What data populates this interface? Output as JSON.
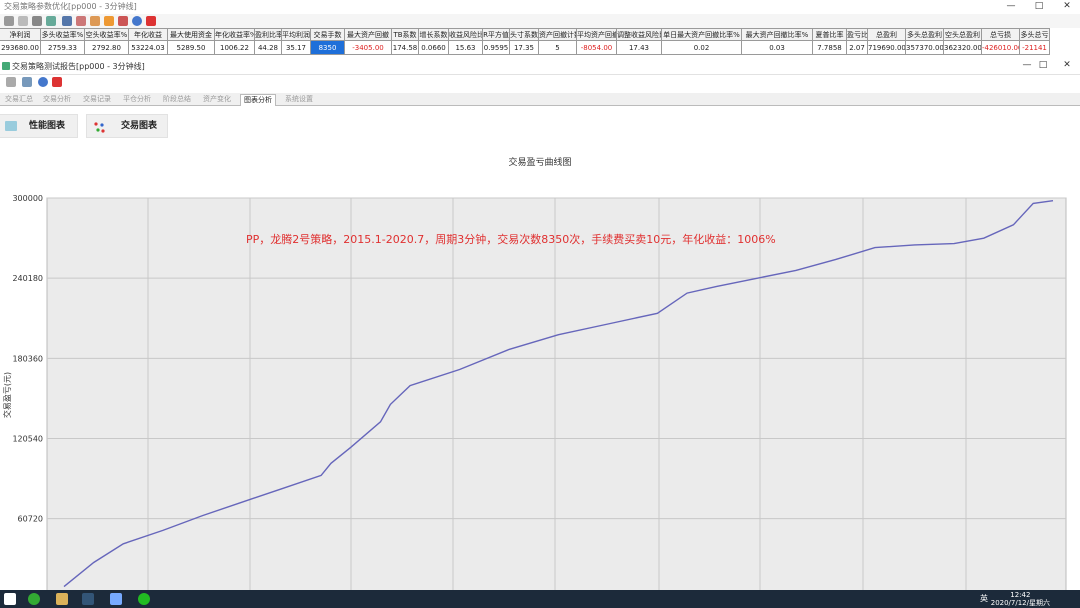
{
  "outer_window": {
    "title": "交易策略参数优化[pp000 - 3分钟线]",
    "controls": [
      "—",
      "□",
      "✕"
    ]
  },
  "stats": {
    "columns": [
      {
        "header": "净利润",
        "value": "293680.00"
      },
      {
        "header": "多头收益率%",
        "value": "2759.33"
      },
      {
        "header": "空头收益率%",
        "value": "2792.80"
      },
      {
        "header": "年化收益",
        "value": "53224.03"
      },
      {
        "header": "最大使用资金",
        "value": "5289.50"
      },
      {
        "header": "年化收益率%",
        "value": "1006.22"
      },
      {
        "header": "盈利比率",
        "value": "44.28"
      },
      {
        "header": "平均利润",
        "value": "35.17"
      },
      {
        "header": "交易手数",
        "value": "8350"
      },
      {
        "header": "最大资产回撤",
        "value": "-3405.00"
      },
      {
        "header": "TB系数",
        "value": "174.58"
      },
      {
        "header": "增长系数",
        "value": "0.0660"
      },
      {
        "header": "收益风险比",
        "value": "15.63"
      },
      {
        "header": "R平方值",
        "value": "0.9595"
      },
      {
        "header": "头寸系数",
        "value": "17.35"
      },
      {
        "header": "资产回撤计数",
        "value": "5"
      },
      {
        "header": "平均资产回撤",
        "value": "-8054.00"
      },
      {
        "header": "调整收益风险比",
        "value": "17.43"
      },
      {
        "header": "单日最大资产回撤比率%",
        "value": "0.02"
      },
      {
        "header": "最大资产回撤比率%",
        "value": "0.03"
      },
      {
        "header": "夏普比率",
        "value": "7.7858"
      },
      {
        "header": "盈亏比",
        "value": "2.07"
      },
      {
        "header": "总盈利",
        "value": "719690.00"
      },
      {
        "header": "多头总盈利",
        "value": "357370.00"
      },
      {
        "header": "空头总盈利",
        "value": "362320.00"
      },
      {
        "header": "总亏损",
        "value": "-426010.00"
      },
      {
        "header": "多头总亏",
        "value": "-21141"
      }
    ]
  },
  "inner_window": {
    "title": "交易策略测试报告[pp000 - 3分钟线]",
    "controls": [
      "—",
      "□",
      "✕"
    ]
  },
  "tabs": [
    "交易汇总",
    "交易分析",
    "交易记录",
    "平仓分析",
    "阶段总结",
    "资产变化",
    "图表分析",
    "系统设置"
  ],
  "active_tab": "图表分析",
  "subtabs": [
    "性能图表",
    "交易图表"
  ],
  "colors": {
    "line": "#6666bb",
    "annotation": "#e03030",
    "selected_cell": "#1e6fd9",
    "taskbar": "#1c2a3a"
  },
  "taskbar": {
    "time": "12:42",
    "date": "2020/7/12/星期六",
    "lang": "英"
  },
  "chart_data": {
    "type": "line",
    "title": "交易盈亏曲线图",
    "ylabel": "交易盈亏(元)",
    "yticks": [
      60720,
      120540,
      180360,
      240180,
      300000
    ],
    "ylim": [
      6000,
      300000
    ],
    "annotation": "PP，龙腾2号策略，2015.1-2020.7，周期3分钟，交易次数8350次，手续费买卖10元，年化收益：1006%",
    "grid": true,
    "series": [
      {
        "x": [
          0,
          0.03,
          0.06,
          0.1,
          0.14,
          0.18,
          0.22,
          0.26,
          0.27,
          0.29,
          0.32,
          0.33,
          0.35,
          0.4,
          0.45,
          0.5,
          0.55,
          0.6,
          0.63,
          0.66,
          0.7,
          0.74,
          0.78,
          0.82,
          0.86,
          0.9,
          0.93,
          0.96,
          0.98,
          1.0
        ],
        "y": [
          10000,
          28000,
          42000,
          52000,
          63000,
          73000,
          83000,
          93000,
          102000,
          114000,
          133000,
          146000,
          160000,
          172000,
          187000,
          198000,
          206000,
          214000,
          229000,
          234000,
          240000,
          246000,
          254000,
          263000,
          265000,
          266000,
          270000,
          280000,
          296000,
          298000
        ]
      }
    ]
  }
}
